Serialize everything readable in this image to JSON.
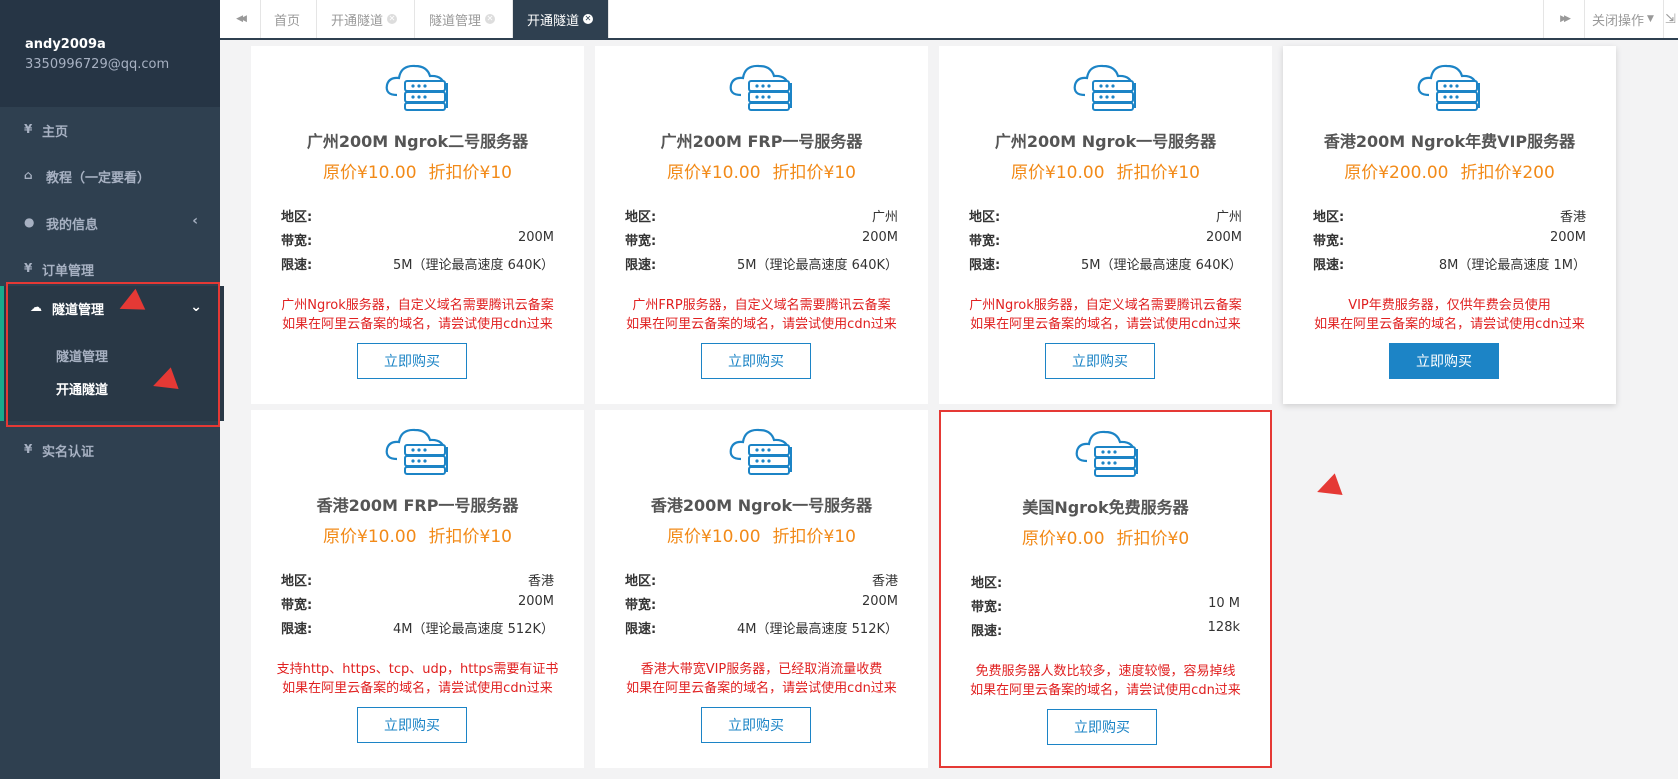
{
  "user": {
    "name": "andy2009a",
    "email": "3350996729@qq.com"
  },
  "nav": {
    "home": "主页",
    "tutorial": "教程（一定要看）",
    "myinfo": "我的信息",
    "orders": "订单管理",
    "tunnel": "隧道管理",
    "tunnel_sub": [
      "隧道管理",
      "开通隧道"
    ],
    "realname": "实名认证",
    "yen_icon": "¥"
  },
  "tabs": {
    "prev": "◀◀",
    "next": "▶▶",
    "items": [
      "首页",
      "开通隧道",
      "隧道管理",
      "开通隧道"
    ],
    "close_ops": "关闭操作"
  },
  "labels": {
    "region": "地区:",
    "bandwidth": "带宽:",
    "speed": "限速:",
    "buy": "立即购买"
  },
  "cards": [
    {
      "title": "广州200M Ngrok二号服务器",
      "orig": "原价¥10.00",
      "disc": "折扣价¥10",
      "region": "",
      "bandwidth": "200M",
      "speed": "5M（理论最高速度 640K）",
      "desc1": "广州Ngrok服务器，自定义域名需要腾讯云备案",
      "desc2": "如果在阿里云备案的域名，请尝试使用cdn过来"
    },
    {
      "title": "广州200M FRP一号服务器",
      "orig": "原价¥10.00",
      "disc": "折扣价¥10",
      "region": "广州",
      "bandwidth": "200M",
      "speed": "5M（理论最高速度 640K）",
      "desc1": "广州FRP服务器，自定义域名需要腾讯云备案",
      "desc2": "如果在阿里云备案的域名，请尝试使用cdn过来"
    },
    {
      "title": "广州200M Ngrok一号服务器",
      "orig": "原价¥10.00",
      "disc": "折扣价¥10",
      "region": "广州",
      "bandwidth": "200M",
      "speed": "5M（理论最高速度 640K）",
      "desc1": "广州Ngrok服务器，自定义域名需要腾讯云备案",
      "desc2": "如果在阿里云备案的域名，请尝试使用cdn过来"
    },
    {
      "title": "香港200M Ngrok年费VIP服务器",
      "orig": "原价¥200.00",
      "disc": "折扣价¥200",
      "region": "香港",
      "bandwidth": "200M",
      "speed": "8M（理论最高速度 1M）",
      "desc1": "VIP年费服务器，仅供年费会员使用",
      "desc2": "如果在阿里云备案的域名，请尝试使用cdn过来"
    },
    {
      "title": "香港200M FRP一号服务器",
      "orig": "原价¥10.00",
      "disc": "折扣价¥10",
      "region": "香港",
      "bandwidth": "200M",
      "speed": "4M（理论最高速度 512K）",
      "desc1": "支持http、https、tcp、udp，https需要有证书",
      "desc2": "如果在阿里云备案的域名，请尝试使用cdn过来"
    },
    {
      "title": "香港200M Ngrok一号服务器",
      "orig": "原价¥10.00",
      "disc": "折扣价¥10",
      "region": "香港",
      "bandwidth": "200M",
      "speed": "4M（理论最高速度 512K）",
      "desc1": "香港大带宽VIP服务器，已经取消流量收费",
      "desc2": "如果在阿里云备案的域名，请尝试使用cdn过来"
    },
    {
      "title": "美国Ngrok免费服务器",
      "orig": "原价¥0.00",
      "disc": "折扣价¥0",
      "region": "",
      "bandwidth": "10 M",
      "speed": "128k",
      "desc1": "免费服务器人数比较多，速度较慢，容易掉线",
      "desc2": "如果在阿里云备案的域名，请尝试使用cdn过来"
    }
  ],
  "colors": {
    "sidebar": "#2f4050",
    "accent": "#1c84c6",
    "price": "#f28a18",
    "warning_text": "#e02020",
    "highlight": "#e53935"
  }
}
